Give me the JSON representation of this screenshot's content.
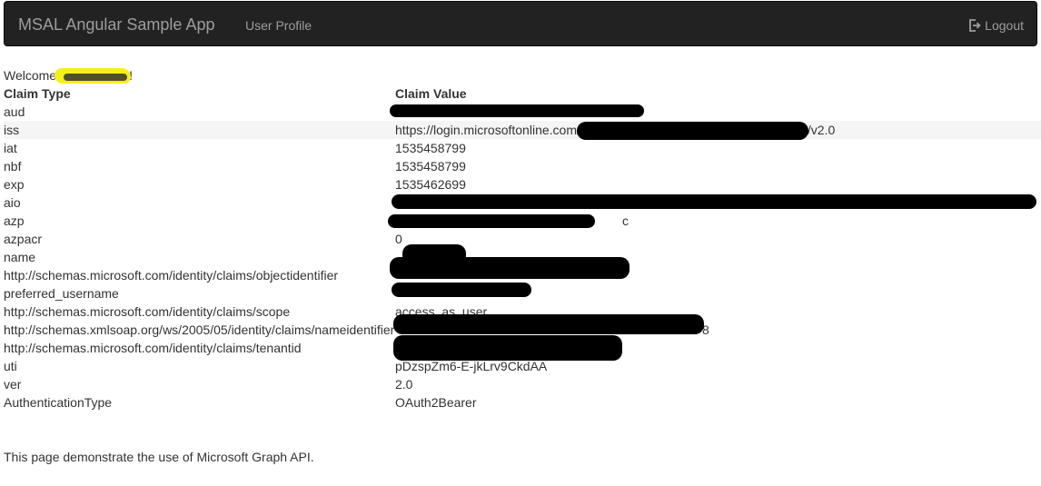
{
  "navbar": {
    "brand": "MSAL Angular Sample App",
    "link_user_profile": "User Profile",
    "logout_label": "Logout",
    "background": "#222222",
    "text_color": "#9d9d9d"
  },
  "welcome": {
    "prefix": "Welcome",
    "suffix": "!"
  },
  "claims_table": {
    "headers": [
      "Claim Type",
      "Claim Value"
    ],
    "rows": [
      {
        "type": "aud",
        "value": ""
      },
      {
        "type": "iss",
        "value": "https://login.microsoftonline.com/",
        "value_suffix": "/v2.0"
      },
      {
        "type": "iat",
        "value": "1535458799"
      },
      {
        "type": "nbf",
        "value": "1535458799"
      },
      {
        "type": "exp",
        "value": "1535462699"
      },
      {
        "type": "aio",
        "value": ""
      },
      {
        "type": "azp",
        "value": "",
        "value_suffix": "c"
      },
      {
        "type": "azpacr",
        "value": "0"
      },
      {
        "type": "name",
        "value": ""
      },
      {
        "type": "http://schemas.microsoft.com/identity/claims/objectidentifier",
        "value": ""
      },
      {
        "type": "preferred_username",
        "value": ""
      },
      {
        "type": "http://schemas.microsoft.com/identity/claims/scope",
        "value": "access_as_user"
      },
      {
        "type": "http://schemas.xmlsoap.org/ws/2005/05/identity/claims/nameidentifier",
        "value": "",
        "value_suffix": "8"
      },
      {
        "type": "http://schemas.microsoft.com/identity/claims/tenantid",
        "value": ""
      },
      {
        "type": "uti",
        "value": "pDzspZm6-E-jkLrv9CkdAA"
      },
      {
        "type": "ver",
        "value": "2.0"
      },
      {
        "type": "AuthenticationType",
        "value": "OAuth2Bearer"
      }
    ]
  },
  "footer": {
    "text": "This page demonstrate the use of Microsoft Graph API."
  },
  "redaction_color": "#000000",
  "highlight_color": "#f5ef1a"
}
